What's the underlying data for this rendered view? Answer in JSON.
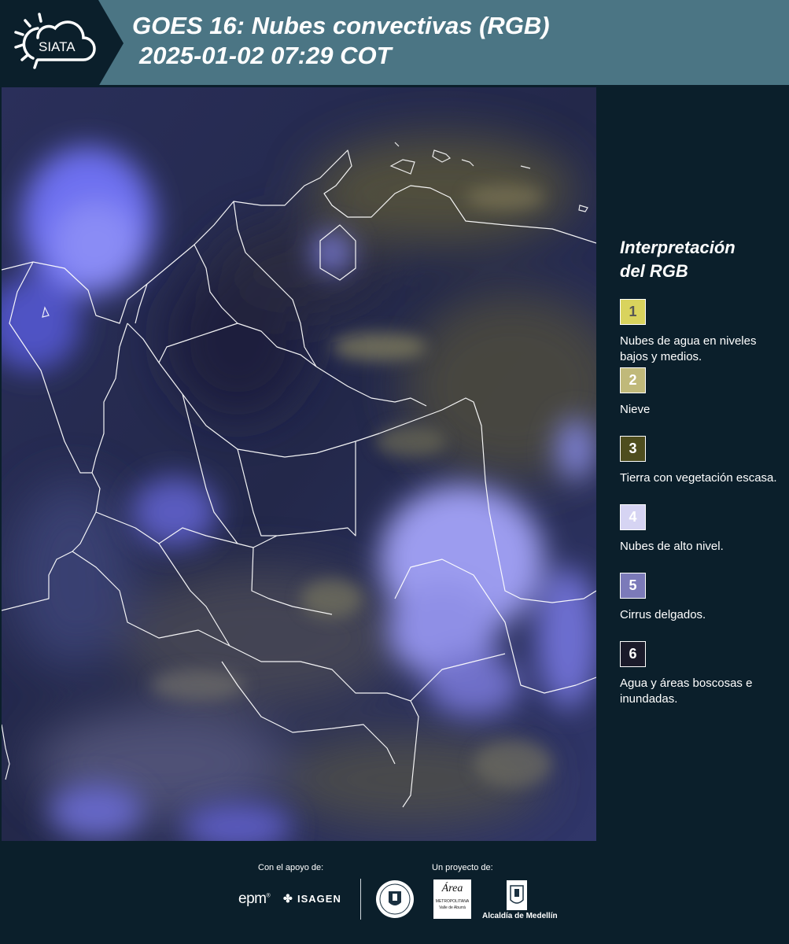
{
  "header": {
    "logo_text": "SIATA",
    "title_line1": "GOES 16: Nubes convectivas (RGB)",
    "title_line2": "2025-01-02 07:29 COT"
  },
  "colors": {
    "header_band": "#4b7584",
    "background": "#0b1f2b"
  },
  "legend": {
    "title_line1": "Interpretación",
    "title_line2": "del RGB",
    "items": [
      {
        "number": "1",
        "color": "#d9d35d",
        "text_color": "#555",
        "label": "Nubes de agua en niveles bajos y medios."
      },
      {
        "number": "2",
        "color": "#c0b97a",
        "text_color": "#fff",
        "label": "Nieve"
      },
      {
        "number": "3",
        "color": "#4e4d1e",
        "text_color": "#fff",
        "label": "Tierra con vegetación escasa."
      },
      {
        "number": "4",
        "color": "#d6d4f3",
        "text_color": "#fff",
        "label": "Nubes de alto nivel."
      },
      {
        "number": "5",
        "color": "#7b7ab9",
        "text_color": "#fff",
        "label": "Cirrus delgados."
      },
      {
        "number": "6",
        "color": "#1a1a2a",
        "text_color": "#fff",
        "label": "Agua y áreas boscosas e inundadas."
      }
    ]
  },
  "footer": {
    "support_label": "Con el apoyo de:",
    "project_label": "Un proyecto de:",
    "epm_text": "epm",
    "isagen_text": "ISAGEN",
    "area_text": "Área",
    "area_sub1": "METROPOLITANA",
    "area_sub2": "Valle de Aburrá",
    "alcaldia_text": "Alcaldía de Medellín"
  }
}
